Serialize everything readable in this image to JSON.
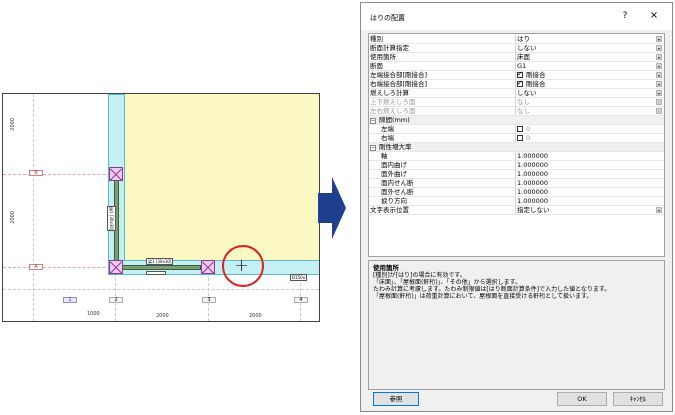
{
  "cad": {
    "dims_left": [
      "2000",
      "2000"
    ],
    "row_labels": [
      "B",
      "A"
    ],
    "col_labels": [
      "1",
      "2",
      "3",
      "4"
    ],
    "dims_bottom": [
      "1000",
      "2000",
      "2000"
    ],
    "beam_tag_h": "梁1 [30x30]",
    "beam_tag_v": "梁1 [30x30]",
    "edge_tag": "D150x"
  },
  "dialog": {
    "title": "はりの配置",
    "help": "?",
    "close": "×",
    "rows": [
      {
        "label": "種別",
        "value": "はり",
        "dropdown": true
      },
      {
        "label": "断面計算指定",
        "value": "しない",
        "dropdown": true
      },
      {
        "label": "使用箇所",
        "value": "床面",
        "dropdown": true
      },
      {
        "label": "断面",
        "value": "G1",
        "dropdown": true
      },
      {
        "label": "左端接合部[剛接合]",
        "value": "剛接合",
        "checkbox": true,
        "dropdown": true
      },
      {
        "label": "右端接合部[剛接合]",
        "value": "剛接合",
        "checkbox": true,
        "dropdown": true
      },
      {
        "label": "燃えしろ計算",
        "value": "しない",
        "dropdown": true
      },
      {
        "label": "上下燃えしろ面",
        "value": "なし",
        "dropdown": true,
        "disabled": true
      },
      {
        "label": "左右燃えしろ面",
        "value": "なし",
        "dropdown": true,
        "disabled": true
      }
    ],
    "section_gap": {
      "label": "隙間(mm)"
    },
    "gap_rows": [
      {
        "label": "左端",
        "value": "0"
      },
      {
        "label": "右端",
        "value": "0"
      }
    ],
    "section_stiff": {
      "label": "剛性増大率"
    },
    "stiff_rows": [
      {
        "label": "軸",
        "value": "1.000000"
      },
      {
        "label": "面内曲げ",
        "value": "1.000000"
      },
      {
        "label": "面外曲げ",
        "value": "1.000000"
      },
      {
        "label": "面内せん断",
        "value": "1.000000"
      },
      {
        "label": "面外せん断",
        "value": "1.000000"
      },
      {
        "label": "捩り方向",
        "value": "1.000000"
      }
    ],
    "last_row": {
      "label": "文字表示位置",
      "value": "指定しない"
    },
    "desc_title": "使用箇所",
    "desc_lines": [
      "[種別]が[はり]の場合に有効です。",
      "「床面」、「屋根面(軒桁)」、「その他」から選択します。",
      "たわみ計算に考慮します。たわみ制限値は[はり断面計算条件]で入力した値となります。",
      "「屋根面(軒桁)」は荷重計算において、屋根面を直接受ける軒桁として扱います。"
    ],
    "btn_ref": "参照",
    "btn_ok": "OK",
    "btn_cancel": "ｷｬﾝｾﾙ"
  },
  "colors": {
    "arrow": "#1f3f8f",
    "highlight_circle": "#e02020",
    "floor": "#fcf8c4",
    "column_strip": "#c4f0f4"
  }
}
